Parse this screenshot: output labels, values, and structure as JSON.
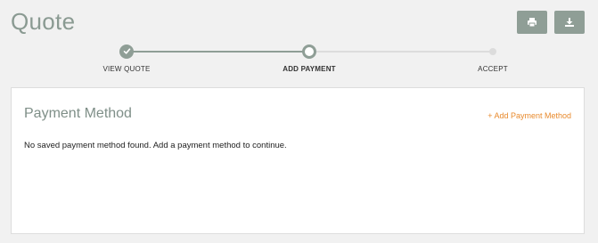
{
  "page": {
    "title": "Quote"
  },
  "actions": {
    "print_icon": "printer-icon",
    "download_icon": "download-icon",
    "color": "#8f9e96"
  },
  "stepper": {
    "steps": [
      {
        "label": "VIEW QUOTE",
        "state": "complete"
      },
      {
        "label": "ADD PAYMENT",
        "state": "current"
      },
      {
        "label": "ACCEPT",
        "state": "upcoming"
      }
    ]
  },
  "payment": {
    "heading": "Payment Method",
    "add_link": "+ Add Payment Method",
    "empty_message": "No saved payment method found. Add a payment method to continue.",
    "link_color": "#e88a2d"
  }
}
